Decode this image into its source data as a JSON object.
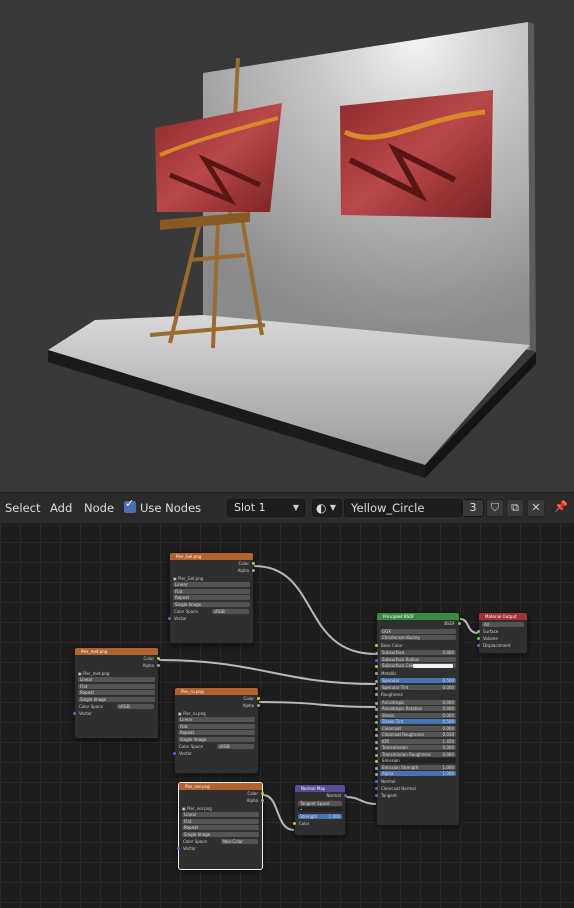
{
  "header": {
    "menu": [
      "Select",
      "Add",
      "Node"
    ],
    "use_nodes_label": "Use Nodes",
    "slot_label": "Slot 1",
    "material_name": "Yellow_Circle",
    "user_count": "3"
  },
  "nodes": {
    "tex1": {
      "title": "Pier_Gel.png",
      "out_color": "Color",
      "out_alpha": "Alpha",
      "image": "Pier_Gel.png",
      "interp": "Linear",
      "proj": "Flat",
      "ext": "Repeat",
      "src": "Single Image",
      "cs_label": "Color Space",
      "cs_value": "sRGB",
      "vector": "Vector"
    },
    "tex2": {
      "title": "Pier_met.png",
      "out_color": "Color",
      "out_alpha": "Alpha",
      "image": "Pier_met.png",
      "interp": "Linear",
      "proj": "Flat",
      "ext": "Repeat",
      "src": "Single Image",
      "cs_label": "Color Space",
      "cs_value": "sRGB",
      "vector": "Vector"
    },
    "tex3": {
      "title": "Pier_ru.png",
      "out_color": "Color",
      "out_alpha": "Alpha",
      "image": "Pier_ru.png",
      "interp": "Linear",
      "proj": "Flat",
      "ext": "Repeat",
      "src": "Single Image",
      "cs_label": "Color Space",
      "cs_value": "sRGB",
      "vector": "Vector"
    },
    "tex4": {
      "title": "Pier_nor.png",
      "out_color": "Color",
      "out_alpha": "Alpha",
      "image": "Pier_nor.png",
      "interp": "Linear",
      "proj": "Flat",
      "ext": "Repeat",
      "src": "Single Image",
      "cs_label": "Color Space",
      "cs_value": "Non-Color",
      "vector": "Vector"
    },
    "normal_map": {
      "title": "Normal Map",
      "out": "Normal",
      "space": "Tangent Space",
      "strength_label": "Strength",
      "strength": "1.000",
      "color": "Color"
    },
    "bsdf": {
      "title": "Principled BSDF",
      "out": "BSDF",
      "dist": "GGX",
      "sss": "Christensen-Burley",
      "rows": [
        {
          "label": "Base Color",
          "value": "",
          "kind": "plain"
        },
        {
          "label": "Subsurface",
          "value": "0.000",
          "kind": "field"
        },
        {
          "label": "Subsurface Radius",
          "value": "",
          "kind": "field"
        },
        {
          "label": "Subsurface Color",
          "value": "",
          "kind": "color"
        },
        {
          "label": "Metallic",
          "value": "",
          "kind": "plain"
        },
        {
          "label": "Specular",
          "value": "0.500",
          "kind": "blue"
        },
        {
          "label": "Specular Tint",
          "value": "0.000",
          "kind": "field"
        },
        {
          "label": "Roughness",
          "value": "",
          "kind": "plain"
        },
        {
          "label": "Anisotropic",
          "value": "0.000",
          "kind": "field"
        },
        {
          "label": "Anisotropic Rotation",
          "value": "0.000",
          "kind": "field"
        },
        {
          "label": "Sheen",
          "value": "0.000",
          "kind": "field"
        },
        {
          "label": "Sheen Tint",
          "value": "0.500",
          "kind": "blue"
        },
        {
          "label": "Clearcoat",
          "value": "0.000",
          "kind": "field"
        },
        {
          "label": "Clearcoat Roughness",
          "value": "0.030",
          "kind": "field"
        },
        {
          "label": "IOR",
          "value": "1.450",
          "kind": "field"
        },
        {
          "label": "Transmission",
          "value": "0.000",
          "kind": "field"
        },
        {
          "label": "Transmission Roughness",
          "value": "0.000",
          "kind": "field"
        },
        {
          "label": "Emission",
          "value": "",
          "kind": "dark"
        },
        {
          "label": "Emission Strength",
          "value": "1.000",
          "kind": "field"
        },
        {
          "label": "Alpha",
          "value": "1.000",
          "kind": "blue"
        },
        {
          "label": "Normal",
          "value": "",
          "kind": "plain"
        },
        {
          "label": "Clearcoat Normal",
          "value": "",
          "kind": "plain"
        },
        {
          "label": "Tangent",
          "value": "",
          "kind": "plain"
        }
      ]
    },
    "output": {
      "title": "Material Output",
      "target": "All",
      "surface": "Surface",
      "volume": "Volume",
      "displacement": "Displacement"
    }
  },
  "colors": {
    "accent": "#4772b3",
    "texture_header": "#b3622e",
    "shader_header": "#3b8a3f",
    "output_header": "#a3323a",
    "vector_header": "#5a4a99"
  }
}
